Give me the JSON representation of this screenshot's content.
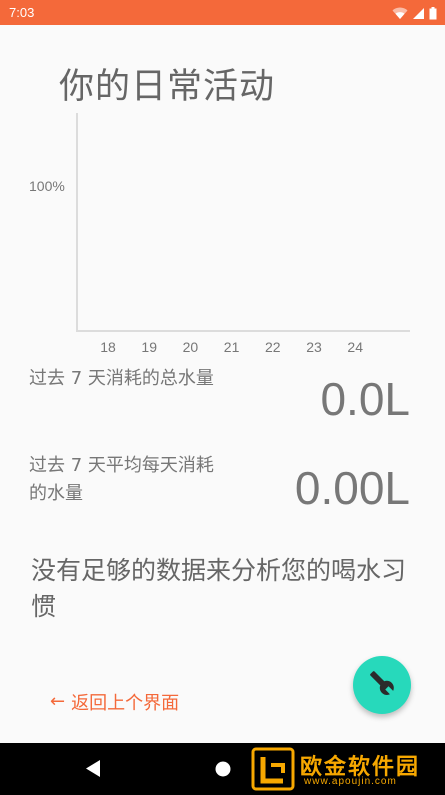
{
  "status_bar": {
    "time": "7:03",
    "color": "#f4693a",
    "icons": [
      "wifi-icon",
      "signal-icon",
      "battery-icon"
    ]
  },
  "page": {
    "title": "你的日常活动"
  },
  "chart_data": {
    "type": "bar",
    "categories": [
      "18",
      "19",
      "20",
      "21",
      "22",
      "23",
      "24"
    ],
    "values": [
      0,
      0,
      0,
      0,
      0,
      0,
      0
    ],
    "y_tick_label": "100%",
    "title": "",
    "xlabel": "",
    "ylabel": "",
    "grid": false
  },
  "stats": {
    "total_label": "过去 7 天消耗的总水量",
    "total_value": "0.0L",
    "avg_label": "过去 7 天平均每天消耗\n的水量",
    "avg_value": "0.00L"
  },
  "message": "没有足够的数据来分析您的喝水习惯",
  "back": {
    "arrow": "←",
    "label": "返回上个界面"
  },
  "fab": {
    "icon": "wrench-icon",
    "color": "#27d9bb"
  },
  "nav_bar": {
    "buttons": [
      "back-triangle-icon",
      "home-circle-icon"
    ]
  },
  "watermark": {
    "title": "欧金软件园",
    "url": "www.apoujin.com",
    "color": "#f7a800"
  }
}
